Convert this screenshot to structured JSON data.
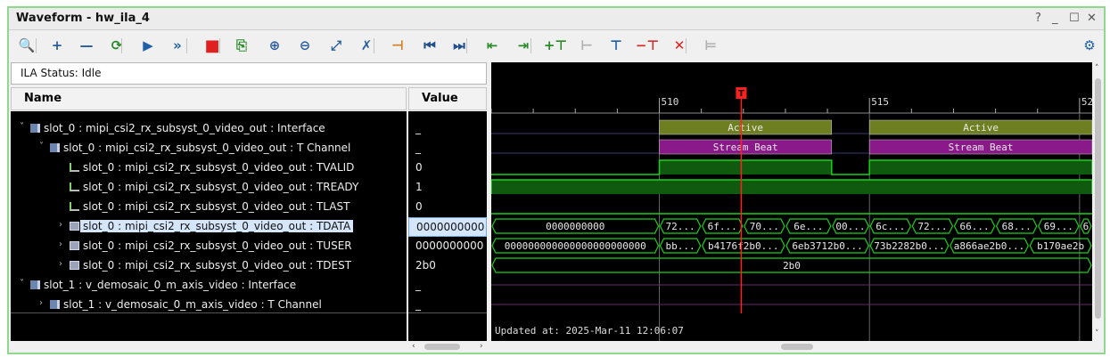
{
  "window": {
    "title": "Waveform - hw_ila_4",
    "controls": [
      "?",
      "_",
      "☐",
      "✕"
    ]
  },
  "toolbar": {
    "icons": [
      {
        "name": "zoom-search-icon",
        "glyph": "🔍",
        "color": "#2a5d9c"
      },
      {
        "name": "add-icon",
        "glyph": "+",
        "color": "#2a5d9c"
      },
      {
        "name": "remove-icon",
        "glyph": "—",
        "color": "#2a5d9c"
      },
      {
        "name": "run-trigger-immediate-icon",
        "glyph": "⟳",
        "color": "#2a8a2a"
      },
      {
        "name": "run-trigger-icon",
        "glyph": "▶",
        "color": "#1f5fa8"
      },
      {
        "name": "auto-retrigger-icon",
        "glyph": "»",
        "color": "#1f5fa8"
      },
      {
        "name": "stop-icon",
        "glyph": "■",
        "color": "#e02020"
      },
      {
        "name": "export-icon",
        "glyph": "⎘",
        "color": "#2a8a2a"
      },
      {
        "name": "zoom-in-icon",
        "glyph": "⊕",
        "color": "#2a5d9c"
      },
      {
        "name": "zoom-out-icon",
        "glyph": "⊖",
        "color": "#2a5d9c"
      },
      {
        "name": "zoom-fit-icon",
        "glyph": "⤢",
        "color": "#2a5d9c"
      },
      {
        "name": "marker-cursor-icon",
        "glyph": "✗",
        "color": "#2a5d9c"
      },
      {
        "name": "goto-cursor-icon",
        "glyph": "⊣",
        "color": "#d08020"
      },
      {
        "name": "go-to-start-icon",
        "glyph": "⏮",
        "color": "#1f4f8f"
      },
      {
        "name": "go-to-end-icon",
        "glyph": "⏭",
        "color": "#1f4f8f"
      },
      {
        "name": "prev-transition-icon",
        "glyph": "⇤",
        "color": "#2a8a2a"
      },
      {
        "name": "next-transition-icon",
        "glyph": "⇥",
        "color": "#2a8a2a"
      },
      {
        "name": "add-marker-icon",
        "glyph": "+⊤",
        "color": "#2a8a2a"
      },
      {
        "name": "prev-marker-icon",
        "glyph": "⊢",
        "color": "#b0b0b0"
      },
      {
        "name": "next-marker-icon",
        "glyph": "⊤",
        "color": "#1f5fa8"
      },
      {
        "name": "delete-marker-icon",
        "glyph": "−⊤",
        "color": "#d03030"
      },
      {
        "name": "delete-all-markers-icon",
        "glyph": "✕",
        "color": "#e02020"
      },
      {
        "name": "swap-cursors-icon",
        "glyph": "⊨",
        "color": "#b0b0b0"
      }
    ],
    "settings_icon": "⚙"
  },
  "status": {
    "label": "ILA Status:",
    "value": "Idle"
  },
  "columns": {
    "name": "Name",
    "value": "Value"
  },
  "signals": [
    {
      "label": "slot_0 : mipi_csi2_rx_subsyst_0_video_out : Interface",
      "value": "_",
      "indent": 0,
      "expand": "˅",
      "icon": "interface"
    },
    {
      "label": "slot_0 : mipi_csi2_rx_subsyst_0_video_out : T Channel",
      "value": "_",
      "indent": 1,
      "expand": "˅",
      "icon": "interface"
    },
    {
      "label": "slot_0 : mipi_csi2_rx_subsyst_0_video_out : TVALID",
      "value": "0",
      "indent": 2,
      "expand": "",
      "icon": "bit"
    },
    {
      "label": "slot_0 : mipi_csi2_rx_subsyst_0_video_out : TREADY",
      "value": "1",
      "indent": 2,
      "expand": "",
      "icon": "bit"
    },
    {
      "label": "slot_0 : mipi_csi2_rx_subsyst_0_video_out : TLAST",
      "value": "0",
      "indent": 2,
      "expand": "",
      "icon": "bit"
    },
    {
      "label": "slot_0 : mipi_csi2_rx_subsyst_0_video_out : TDATA",
      "value": "0000000000",
      "indent": 2,
      "expand": "›",
      "icon": "bus",
      "selected": true
    },
    {
      "label": "slot_0 : mipi_csi2_rx_subsyst_0_video_out : TUSER",
      "value": "0000000000",
      "indent": 2,
      "expand": "›",
      "icon": "bus"
    },
    {
      "label": "slot_0 : mipi_csi2_rx_subsyst_0_video_out : TDEST",
      "value": "2b0",
      "indent": 2,
      "expand": "›",
      "icon": "bus"
    },
    {
      "label": "slot_1 : v_demosaic_0_m_axis_video : Interface",
      "value": "_",
      "indent": 0,
      "expand": "˅",
      "icon": "interface"
    },
    {
      "label": "slot_1 : v_demosaic_0_m_axis_video : T Channel",
      "value": "_",
      "indent": 1,
      "expand": "›",
      "icon": "interface"
    }
  ],
  "waveform": {
    "ruler": [
      {
        "t": 510,
        "label": "510"
      },
      {
        "t": 515,
        "label": "515"
      },
      {
        "t": 520,
        "label": "52"
      }
    ],
    "trigger": {
      "t": 511.95,
      "label": "T"
    },
    "view": {
      "t0": 506,
      "t1": 520.3
    },
    "updated": "Updated at: 2025-Mar-11 12:06:07",
    "colors": {
      "active": "#6e7f22",
      "stream": "#8a1a8a",
      "green": "#19d119",
      "dark": "#0f5a0f",
      "trigger": "#ff2020"
    },
    "lanes": [
      {
        "type": "state",
        "segs": [
          {
            "t0": 510,
            "t1": 514.1,
            "text": "Active",
            "kind": "active"
          },
          {
            "t0": 515,
            "t1": 520.3,
            "text": "Active",
            "kind": "active"
          }
        ]
      },
      {
        "type": "state",
        "segs": [
          {
            "t0": 510,
            "t1": 514.1,
            "text": "Stream Beat",
            "kind": "stream"
          },
          {
            "t0": 515,
            "t1": 520.3,
            "text": "Stream Beat",
            "kind": "stream"
          }
        ]
      },
      {
        "type": "bit",
        "high": [
          [
            510,
            514.1
          ],
          [
            515,
            520.3
          ]
        ]
      },
      {
        "type": "bit",
        "high": [
          [
            506,
            520.3
          ]
        ]
      },
      {
        "type": "bit",
        "high": []
      },
      {
        "type": "bus",
        "segs": [
          {
            "t0": 506,
            "t1": 510,
            "text": "0000000000"
          },
          {
            "t0": 510,
            "t1": 511,
            "text": "72..."
          },
          {
            "t0": 511,
            "t1": 512,
            "text": "6f..."
          },
          {
            "t0": 512,
            "t1": 513,
            "text": "70..."
          },
          {
            "t0": 513,
            "t1": 514.1,
            "text": "6e..."
          },
          {
            "t0": 514.1,
            "t1": 515,
            "text": "00..."
          },
          {
            "t0": 515,
            "t1": 516,
            "text": "6c..."
          },
          {
            "t0": 516,
            "t1": 517,
            "text": "72..."
          },
          {
            "t0": 517,
            "t1": 518,
            "text": "66..."
          },
          {
            "t0": 518,
            "t1": 519,
            "text": "68..."
          },
          {
            "t0": 519,
            "t1": 520,
            "text": "69..."
          },
          {
            "t0": 520,
            "t1": 520.3,
            "text": "6"
          }
        ]
      },
      {
        "type": "bus",
        "segs": [
          {
            "t0": 506,
            "t1": 510,
            "text": "000000000000000000000000"
          },
          {
            "t0": 510,
            "t1": 511,
            "text": "bb..."
          },
          {
            "t0": 511,
            "t1": 513,
            "text": "b4176f2b0..."
          },
          {
            "t0": 513,
            "t1": 515,
            "text": "6eb3712b0..."
          },
          {
            "t0": 515,
            "t1": 516.9,
            "text": "73b2282b0..."
          },
          {
            "t0": 516.9,
            "t1": 518.8,
            "text": "a866ae2b0..."
          },
          {
            "t0": 518.8,
            "t1": 520.3,
            "text": "b170ae2b"
          }
        ]
      },
      {
        "type": "bus",
        "segs": [
          {
            "t0": 506,
            "t1": 520.3,
            "text": "2b0"
          }
        ]
      },
      {
        "type": "flat"
      },
      {
        "type": "flat"
      }
    ]
  }
}
